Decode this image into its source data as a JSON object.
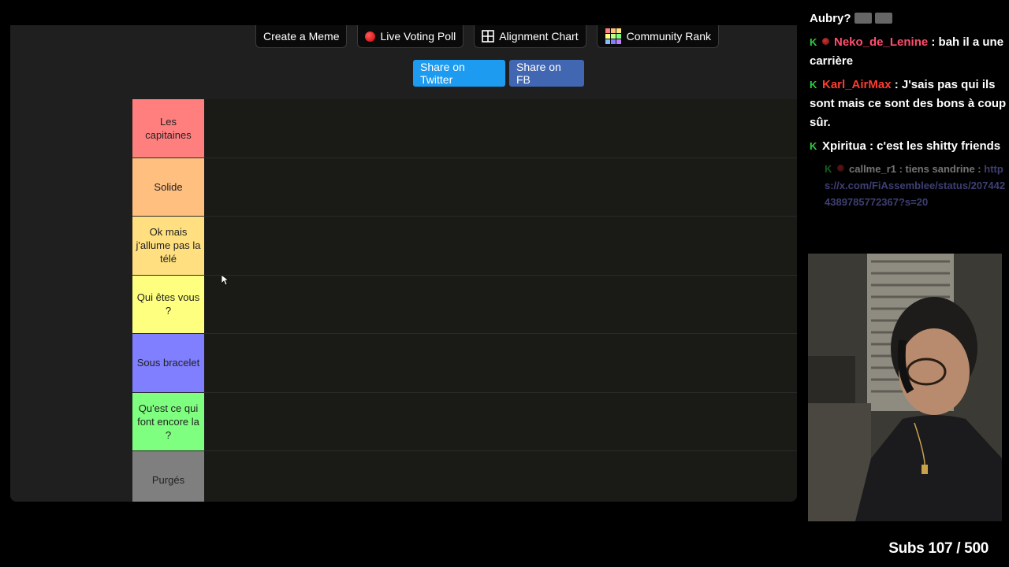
{
  "toolbar": {
    "create_meme": "Create a Meme",
    "live_poll": "Live Voting Poll",
    "alignment_chart": "Alignment Chart",
    "community_rank": "Community Rank"
  },
  "share": {
    "twitter": "Share on Twitter",
    "fb": "Share on FB"
  },
  "tiers": [
    {
      "label": "Les capitaines",
      "color": "#ff7f7f"
    },
    {
      "label": "Solide",
      "color": "#ffbf7f"
    },
    {
      "label": "Ok mais j'allume pas la télé",
      "color": "#ffdf7f"
    },
    {
      "label": "Qui êtes vous ?",
      "color": "#ffff7f"
    },
    {
      "label": "Sous bracelet",
      "color": "#7f7fff"
    },
    {
      "label": "Qu'est ce qui font encore la ?",
      "color": "#7fff7f"
    },
    {
      "label": "Purgés",
      "color": "#7f7f7f"
    }
  ],
  "chat": {
    "partial_top": "Aubry?",
    "messages": [
      {
        "user": "Neko_de_Lenine",
        "color": "#ff4d6d",
        "text": " : bah il a une carrière"
      },
      {
        "user": "Karl_AirMax",
        "color": "#ff3b30",
        "text": " : J'sais pas qui ils sont mais ce sont des bons à coup sûr."
      },
      {
        "user": "Xpiritua",
        "color": "#ffffff",
        "text": " : c'est les shitty friends"
      }
    ],
    "faded": {
      "user": "callme_r1",
      "text": " : tiens sandrine : ",
      "link": "https://x.com/FiAssemblee/status/2074424389785772367?s=20"
    }
  },
  "subs_counter": "Subs 107 / 500"
}
